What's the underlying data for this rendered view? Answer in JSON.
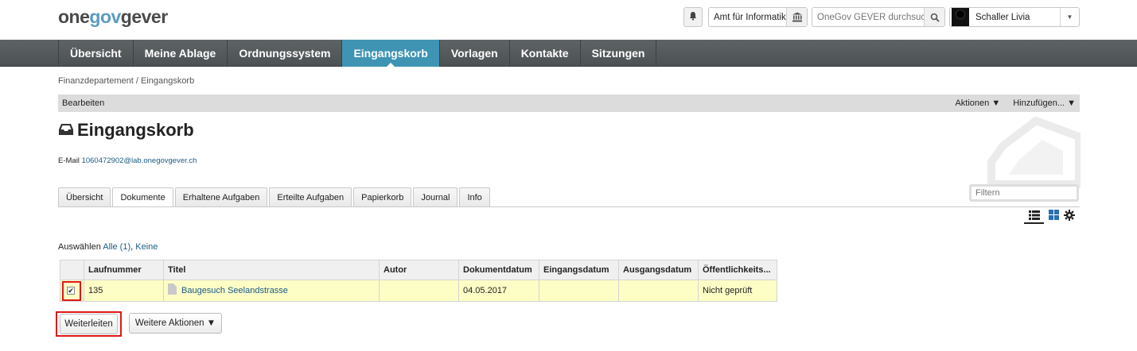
{
  "logo": {
    "part1": "one",
    "part2": "gov",
    "part3": "gever"
  },
  "header": {
    "org_unit": "Amt für Informatik",
    "search_placeholder": "OneGov GEVER durchsuc",
    "user_name": "Schaller Livia"
  },
  "nav": {
    "items": [
      {
        "label": "Übersicht"
      },
      {
        "label": "Meine Ablage"
      },
      {
        "label": "Ordnungssystem"
      },
      {
        "label": "Eingangskorb",
        "active": true
      },
      {
        "label": "Vorlagen"
      },
      {
        "label": "Kontakte"
      },
      {
        "label": "Sitzungen"
      }
    ]
  },
  "breadcrumb": "Finanzdepartement / Eingangskorb",
  "action_bar": {
    "edit": "Bearbeiten",
    "actions": "Aktionen ▼",
    "add": "Hinzufügen... ▼"
  },
  "page": {
    "title": "Eingangskorb",
    "email_label": "E-Mail",
    "email": "1060472902@lab.onegovgever.ch"
  },
  "tabs": [
    {
      "label": "Übersicht"
    },
    {
      "label": "Dokumente",
      "active": true
    },
    {
      "label": "Erhaltene Aufgaben"
    },
    {
      "label": "Erteilte Aufgaben"
    },
    {
      "label": "Papierkorb"
    },
    {
      "label": "Journal"
    },
    {
      "label": "Info"
    }
  ],
  "filter": {
    "placeholder": "Filtern"
  },
  "selection": {
    "label": "Auswählen",
    "all": "Alle (1)",
    "sep": ",",
    "none": "Keine"
  },
  "table": {
    "columns": [
      "Laufnummer",
      "Titel",
      "Autor",
      "Dokumentdatum",
      "Eingangsdatum",
      "Ausgangsdatum",
      "Öffentlichkeits..."
    ],
    "rows": [
      {
        "checked": true,
        "laufnummer": "135",
        "titel": "Baugesuch Seelandstrasse",
        "autor": "",
        "dokumentdatum": "04.05.2017",
        "eingangsdatum": "",
        "ausgangsdatum": "",
        "oeffentlichkeit": "Nicht geprüft"
      }
    ]
  },
  "buttons": {
    "forward": "Weiterleiten",
    "more": "Weitere Aktionen ▼"
  },
  "colors": {
    "nav_bg": "#555b5d",
    "nav_active": "#3f94b3",
    "row_selected": "#fdfdc6",
    "link": "#1c5b86",
    "highlight": "#e01818"
  },
  "icons": [
    "bell-icon",
    "building-icon",
    "search-icon",
    "avatar",
    "chevron-down-icon",
    "inbox-icon",
    "list-view-icon",
    "grid-view-icon",
    "gear-icon",
    "document-icon"
  ]
}
